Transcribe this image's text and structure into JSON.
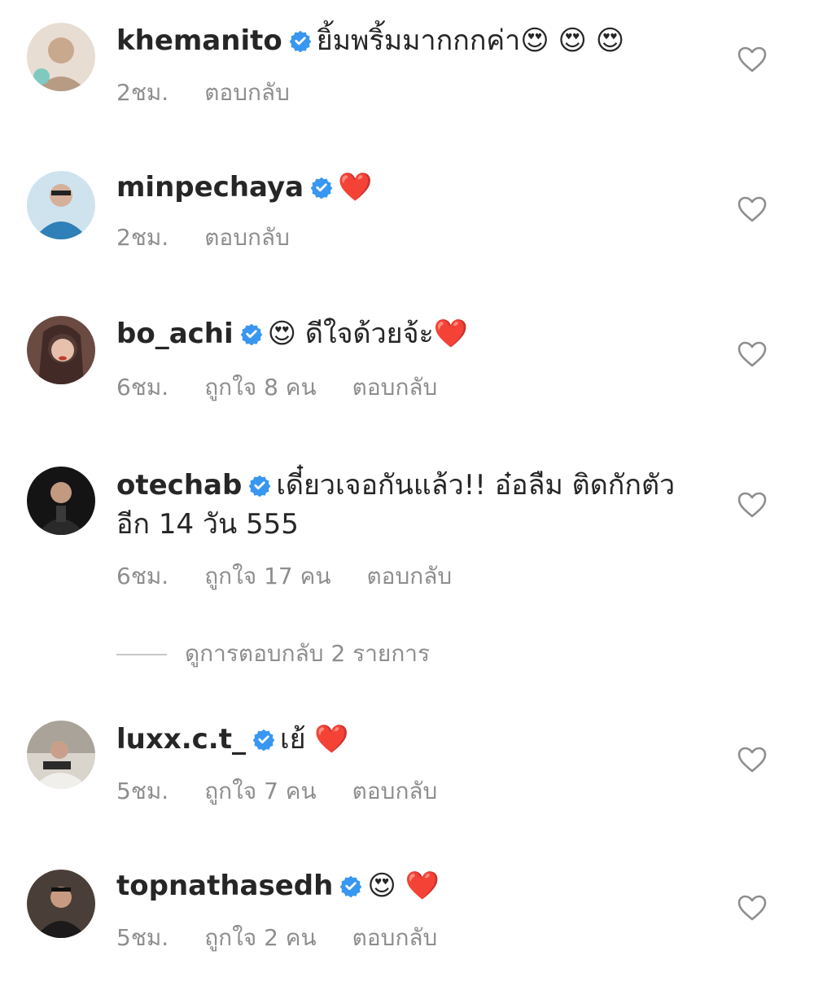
{
  "comments": [
    {
      "username": "khemanito",
      "text": "ยิ้มพริ้มมากกกค่า😍 😍 😍",
      "time": "2ชม.",
      "likes": "",
      "reply": "ตอบกลับ",
      "avatar_color": "#d9c7b7"
    },
    {
      "username": "minpechaya",
      "text": "❤️",
      "time": "2ชม.",
      "likes": "",
      "reply": "ตอบกลับ",
      "avatar_color": "#2f7fb8"
    },
    {
      "username": "bo_achi",
      "text": "😍 ดีใจด้วยจ้ะ❤️",
      "time": "6ชม.",
      "likes": "ถูกใจ 8 คน",
      "reply": "ตอบกลับ",
      "avatar_color": "#5a3a34"
    },
    {
      "username": "otechab",
      "text": "เดี๋ยวเจอกันแล้ว!! อ๋อลืม ติดกักตัว อีก 14 วัน 555",
      "time": "6ชม.",
      "likes": "ถูกใจ 17 คน",
      "reply": "ตอบกลับ",
      "avatar_color": "#1e1e1e"
    },
    {
      "username": "luxx.c.t_",
      "text": "เย้ ❤️",
      "time": "5ชม.",
      "likes": "ถูกใจ 7 คน",
      "reply": "ตอบกลับ",
      "avatar_color": "#c9c4bd"
    },
    {
      "username": "topnathasedh",
      "text": "😍 ❤️",
      "time": "5ชม.",
      "likes": "ถูกใจ 2 คน",
      "reply": "ตอบกลับ",
      "avatar_color": "#2b2624"
    }
  ],
  "view_replies": "ดูการตอบกลับ 2 รายการ",
  "colors": {
    "verified": "#3897f0",
    "meta_text": "#8e8e8e",
    "heart_stroke": "#8e8e8e"
  },
  "icons": {
    "verified": "verified-badge-icon",
    "like": "heart-outline-icon"
  }
}
